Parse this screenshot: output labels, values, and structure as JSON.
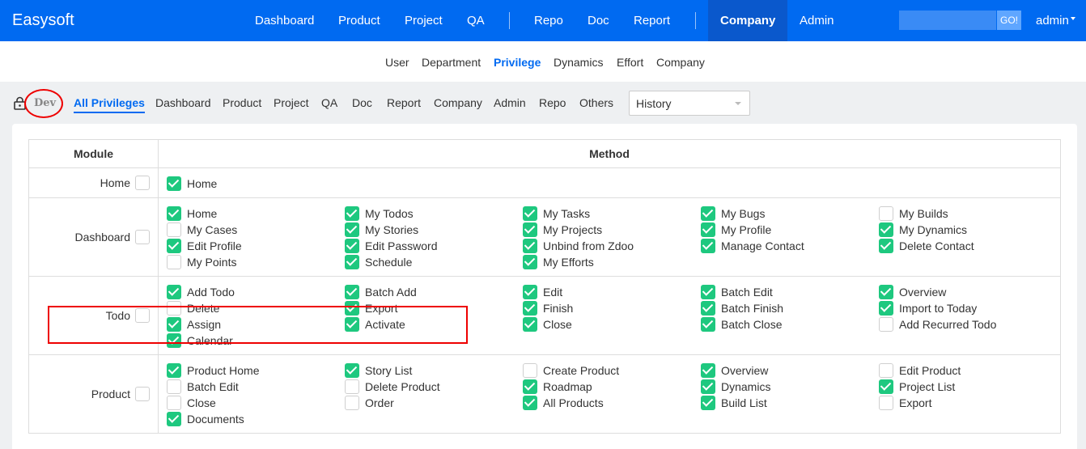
{
  "app": {
    "brand": "Easysoft"
  },
  "topnav": {
    "items": [
      "Dashboard",
      "Product",
      "Project",
      "QA",
      "Repo",
      "Doc",
      "Report"
    ],
    "company": "Company",
    "admin_link": "Admin",
    "search_placeholder": "",
    "go": "GO!",
    "user": "admin"
  },
  "subnav": {
    "items": [
      "User",
      "Department",
      "Privilege",
      "Dynamics",
      "Effort",
      "Company"
    ],
    "active": "Privilege"
  },
  "filter": {
    "group": "Dev",
    "items": [
      "All Privileges",
      "Dashboard",
      "Product",
      "Project",
      "QA",
      "Doc",
      "Report",
      "Company",
      "Admin",
      "Repo",
      "Others"
    ],
    "active": "All Privileges",
    "history": "History"
  },
  "table": {
    "headers": {
      "module": "Module",
      "method": "Method"
    },
    "rows": [
      {
        "module": "Home",
        "checked": false,
        "methods": [
          {
            "label": "Home",
            "checked": true
          }
        ]
      },
      {
        "module": "Dashboard",
        "checked": false,
        "methods": [
          {
            "label": "Home",
            "checked": true
          },
          {
            "label": "My Todos",
            "checked": true
          },
          {
            "label": "My Tasks",
            "checked": true
          },
          {
            "label": "My Bugs",
            "checked": true
          },
          {
            "label": "My Builds",
            "checked": false
          },
          {
            "label": "My Cases",
            "checked": false
          },
          {
            "label": "My Stories",
            "checked": true
          },
          {
            "label": "My Projects",
            "checked": true
          },
          {
            "label": "My Profile",
            "checked": true
          },
          {
            "label": "My Dynamics",
            "checked": true
          },
          {
            "label": "Edit Profile",
            "checked": true
          },
          {
            "label": "Edit Password",
            "checked": true
          },
          {
            "label": "Unbind from Zdoo",
            "checked": true
          },
          {
            "label": "Manage Contact",
            "checked": true
          },
          {
            "label": "Delete Contact",
            "checked": true
          },
          {
            "label": "My Points",
            "checked": false
          },
          {
            "label": "Schedule",
            "checked": true
          },
          {
            "label": "My Efforts",
            "checked": true
          }
        ]
      },
      {
        "module": "Todo",
        "checked": false,
        "methods": [
          {
            "label": "Add Todo",
            "checked": true
          },
          {
            "label": "Batch Add",
            "checked": true
          },
          {
            "label": "Edit",
            "checked": true
          },
          {
            "label": "Batch Edit",
            "checked": true
          },
          {
            "label": "Overview",
            "checked": true
          },
          {
            "label": "Delete",
            "checked": false
          },
          {
            "label": "Export",
            "checked": true
          },
          {
            "label": "Finish",
            "checked": true
          },
          {
            "label": "Batch Finish",
            "checked": true
          },
          {
            "label": "Import to Today",
            "checked": true
          },
          {
            "label": "Assign",
            "checked": true
          },
          {
            "label": "Activate",
            "checked": true
          },
          {
            "label": "Close",
            "checked": true
          },
          {
            "label": "Batch Close",
            "checked": true
          },
          {
            "label": "Add Recurred Todo",
            "checked": false
          },
          {
            "label": "Calendar",
            "checked": true
          }
        ]
      },
      {
        "module": "Product",
        "checked": false,
        "methods": [
          {
            "label": "Product Home",
            "checked": true
          },
          {
            "label": "Story List",
            "checked": true
          },
          {
            "label": "Create Product",
            "checked": false
          },
          {
            "label": "Overview",
            "checked": true
          },
          {
            "label": "Edit Product",
            "checked": false
          },
          {
            "label": "Batch Edit",
            "checked": false
          },
          {
            "label": "Delete Product",
            "checked": false
          },
          {
            "label": "Roadmap",
            "checked": true
          },
          {
            "label": "Dynamics",
            "checked": true
          },
          {
            "label": "Project List",
            "checked": true
          },
          {
            "label": "Close",
            "checked": false
          },
          {
            "label": "Order",
            "checked": false
          },
          {
            "label": "All Products",
            "checked": true
          },
          {
            "label": "Build List",
            "checked": true
          },
          {
            "label": "Export",
            "checked": false
          },
          {
            "label": "Documents",
            "checked": true
          }
        ]
      }
    ]
  },
  "colors": {
    "primary": "#006af1",
    "active_nav": "#0a58cc",
    "check": "#1ec87f",
    "annotation": "#e00000"
  }
}
